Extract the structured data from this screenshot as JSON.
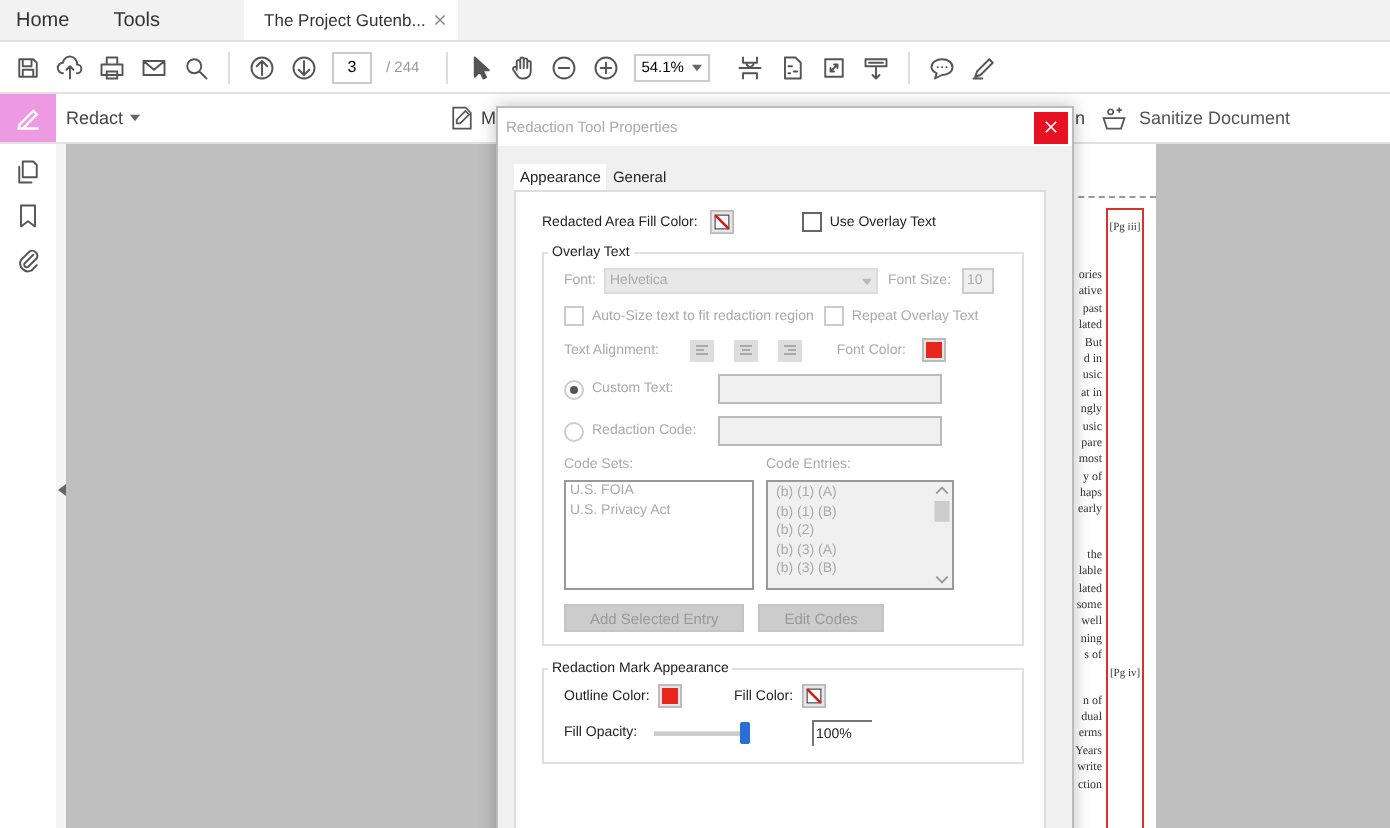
{
  "tabs": [
    {
      "label": "Home",
      "selected": false,
      "closable": false
    },
    {
      "label": "Tools",
      "selected": false,
      "closable": false
    },
    {
      "label": "The Project Gutenb...",
      "selected": true,
      "closable": true
    }
  ],
  "toolbar": {
    "page_number": "3",
    "page_total": "/ 244",
    "zoom": "54.1%"
  },
  "redact_bar": {
    "tool": "Redact",
    "left_tool": "M",
    "right_tool": "n",
    "sanitize": "Sanitize Document"
  },
  "page": {
    "paragraphs": [
      [
        "ories",
        "ative",
        "past",
        "lated",
        "But",
        "d in",
        "usic",
        "at in",
        "ngly",
        "usic",
        "pare",
        "most",
        "y of",
        "haps",
        "early"
      ],
      [
        "the",
        "lable",
        "lated",
        "some",
        "well",
        "ning",
        "s of"
      ],
      [
        "n of",
        "dual",
        "erms",
        "Years",
        "write",
        "ction"
      ]
    ],
    "redaction_labels": [
      "[Pg iii]",
      "[Pg iv]"
    ]
  },
  "dialog": {
    "title": "Redaction Tool Properties",
    "tabs": [
      {
        "label": "Appearance",
        "selected": true
      },
      {
        "label": "General",
        "selected": false
      }
    ],
    "fill_color_label": "Redacted Area Fill Color:",
    "fill_swatch": {
      "kind": "none"
    },
    "use_overlay": {
      "label": "Use Overlay Text",
      "checked": false
    },
    "overlay": {
      "title": "Overlay Text",
      "disabled": true,
      "font_label": "Font:",
      "font_value": "Helvetica",
      "font_size_label": "Font Size:",
      "font_size": "10",
      "auto_size": {
        "label": "Auto-Size text to fit redaction region",
        "checked": false
      },
      "repeat": {
        "label": "Repeat Overlay Text",
        "checked": false
      },
      "alignment_label": "Text Alignment:",
      "font_color_label": "Font Color:",
      "font_color": {
        "kind": "solid",
        "color": "#e8261c"
      },
      "custom_text": {
        "label": "Custom Text:",
        "selected": true
      },
      "redaction_code": {
        "label": "Redaction Code:",
        "selected": false
      },
      "code_sets_label": "Code Sets:",
      "code_entries_label": "Code Entries:",
      "code_sets": [
        "U.S. FOIA",
        "U.S. Privacy Act"
      ],
      "code_entries": [
        "(b) (1) (A)",
        "(b) (1) (B)",
        "(b) (2)",
        "(b) (3) (A)",
        "(b) (3) (B)"
      ],
      "buttons": [
        "Add Selected Entry",
        "Edit Codes"
      ]
    },
    "mark": {
      "title": "Redaction Mark Appearance",
      "outline_label": "Outline Color:",
      "outline_swatch": {
        "kind": "solid",
        "color": "#e8261c"
      },
      "fill_label": "Fill Color:",
      "fill_swatch": {
        "kind": "none"
      },
      "opacity_label": "Fill Opacity:",
      "opacity": {
        "level": 1
      },
      "opacity_value": "100%"
    }
  }
}
